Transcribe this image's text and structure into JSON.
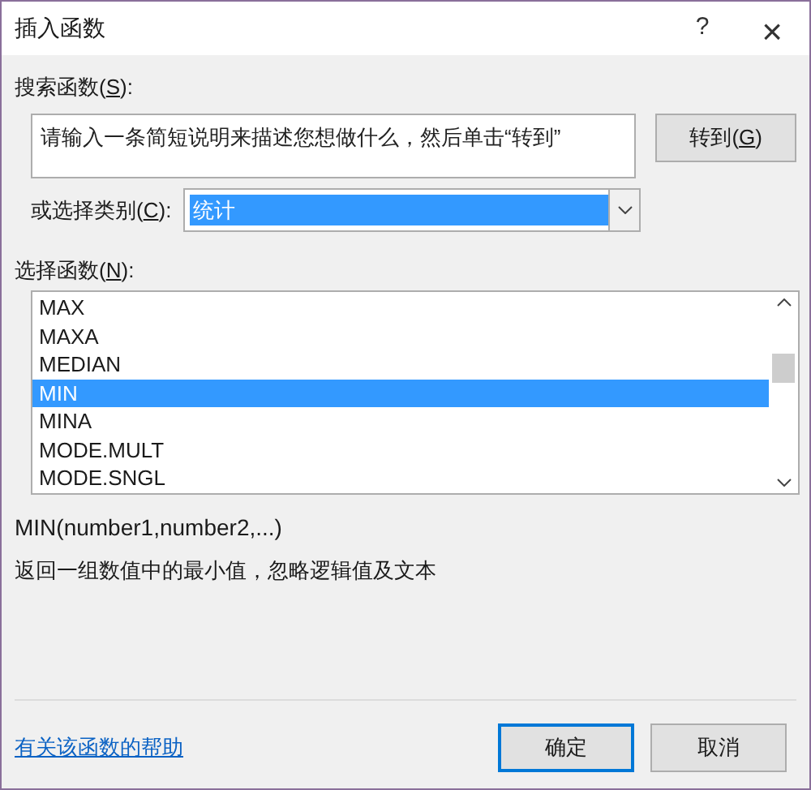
{
  "window": {
    "title": "插入函数",
    "help_button": "?",
    "close_button": "×"
  },
  "search": {
    "label": {
      "before": "搜索函数(",
      "key": "S",
      "after": "):"
    },
    "placeholder": "请输入一条简短说明来描述您想做什么，然后单击“转到”",
    "go_button": {
      "before": "转到(",
      "key": "G",
      "after": ")"
    }
  },
  "category": {
    "label": {
      "before": "或选择类别(",
      "key": "C",
      "after": "):"
    },
    "value": "统计"
  },
  "functions": {
    "label": {
      "before": "选择函数(",
      "key": "N",
      "after": "):"
    },
    "items": [
      {
        "name": "MAX",
        "selected": false
      },
      {
        "name": "MAXA",
        "selected": false
      },
      {
        "name": "MEDIAN",
        "selected": false
      },
      {
        "name": "MIN",
        "selected": true
      },
      {
        "name": "MINA",
        "selected": false
      },
      {
        "name": "MODE.MULT",
        "selected": false
      },
      {
        "name": "MODE.SNGL",
        "selected": false
      }
    ]
  },
  "signature": "MIN(number1,number2,...)",
  "description": "返回一组数值中的最小值，忽略逻辑值及文本",
  "help_link": "有关该函数的帮助",
  "buttons": [
    {
      "label": "确定",
      "default": true
    },
    {
      "label": "取消",
      "default": false
    }
  ]
}
